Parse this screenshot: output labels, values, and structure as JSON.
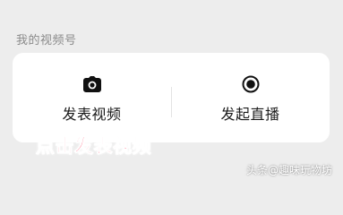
{
  "section": {
    "title": "我的视频号"
  },
  "actions": [
    {
      "label": "发表视频",
      "icon": "camera-icon"
    },
    {
      "label": "发起直播",
      "icon": "live-record-icon"
    }
  ],
  "overlay": {
    "text": "点击发表视频",
    "color": "#ff2d55"
  },
  "watermark": {
    "text": "头条@趣味玩物坊"
  }
}
